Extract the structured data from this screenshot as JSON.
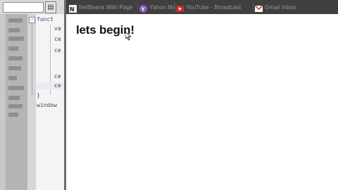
{
  "editor": {
    "toolbar": {
      "search_value": "",
      "panel_button_icon": "panel-icon"
    },
    "fold_marker": "−",
    "code_lines": [
      "funct",
      "va",
      "ce",
      "ce",
      "ce",
      "ce",
      "}",
      "window"
    ]
  },
  "browser": {
    "bookmarks": [
      {
        "icon": "nb-icon",
        "label": "NetBeans Wiki Page",
        "color": "#e0e0e0"
      },
      {
        "icon": "y-icon",
        "label": "Yahoo Mail link",
        "color": "#8e5bc1"
      },
      {
        "icon": "youtube-icon",
        "label": "YouTube - Broadcast",
        "color": "#c4302b"
      },
      {
        "icon": "gmail-icon",
        "label": "Gmail inbox",
        "color": "#cc3a2f"
      }
    ]
  },
  "page": {
    "heading": "lets begin!"
  }
}
